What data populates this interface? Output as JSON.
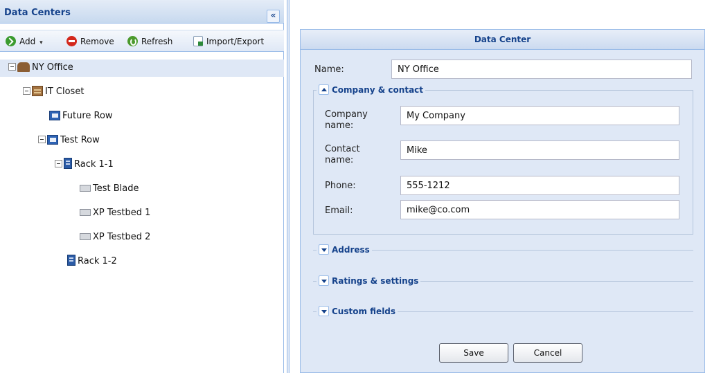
{
  "left_panel": {
    "title": "Data Centers",
    "collapse_glyph": "«",
    "toolbar": {
      "add_label": "Add",
      "add_caret": "▾",
      "remove_label": "Remove",
      "refresh_label": "Refresh",
      "import_export_label": "Import/Export"
    },
    "tree": {
      "nodes": [
        {
          "label": "NY Office",
          "icon": "office-icon",
          "expanded": true,
          "selected": true
        },
        {
          "label": "IT Closet",
          "icon": "closet-icon",
          "expanded": true
        },
        {
          "label": "Future Row",
          "icon": "row-icon"
        },
        {
          "label": "Test Row",
          "icon": "row-icon",
          "expanded": true
        },
        {
          "label": "Rack 1-1",
          "icon": "rack-icon",
          "expanded": true
        },
        {
          "label": "Test Blade",
          "icon": "blade-icon"
        },
        {
          "label": "XP Testbed 1",
          "icon": "blade-icon"
        },
        {
          "label": "XP Testbed 2",
          "icon": "blade-icon"
        },
        {
          "label": "Rack 1-2",
          "icon": "rack-icon"
        }
      ]
    }
  },
  "form": {
    "title": "Data Center",
    "name_label": "Name:",
    "name_value": "NY Office",
    "company_contact": {
      "legend": "Company & contact",
      "expanded": true,
      "company_name_label_1": "Company",
      "company_name_label_2": "name:",
      "company_name_value": "My Company",
      "contact_name_label_1": "Contact",
      "contact_name_label_2": "name:",
      "contact_name_value": "Mike",
      "phone_label": "Phone:",
      "phone_value": "555-1212",
      "email_label": "Email:",
      "email_value": "mike@co.com"
    },
    "sections": {
      "address": "Address",
      "ratings": "Ratings & settings",
      "custom": "Custom fields"
    },
    "save_label": "Save",
    "cancel_label": "Cancel"
  },
  "colors": {
    "panel_border": "#99bbe8",
    "header_text": "#15428b",
    "selection": "#dfe8f6"
  }
}
